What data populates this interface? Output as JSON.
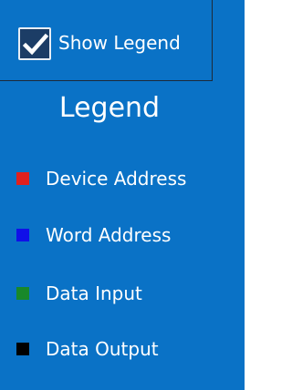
{
  "toggle": {
    "label": "Show Legend",
    "checked": true,
    "icon": "checkmark-icon"
  },
  "legend": {
    "title": "Legend",
    "items": [
      {
        "label": "Device Address",
        "color": "#e0201e"
      },
      {
        "label": "Word Address",
        "color": "#1010e8"
      },
      {
        "label": "Data Input",
        "color": "#18882a"
      },
      {
        "label": "Data Output",
        "color": "#000000"
      }
    ]
  },
  "colors": {
    "panel_background": "#0a72c6",
    "checkbox_fill": "#1c3d66",
    "text": "#ffffff"
  }
}
